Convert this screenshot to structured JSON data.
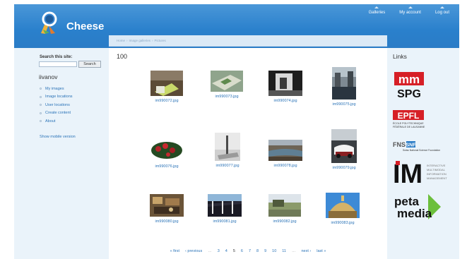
{
  "header": {
    "site_name": "Cheese",
    "nav": [
      "Galleries",
      "My account",
      "Log out"
    ]
  },
  "breadcrumb": [
    "Home",
    "Image galleries",
    "Pictures"
  ],
  "sidebar": {
    "search_label": "Search this site:",
    "search_value": "",
    "search_button": "Search",
    "username": "iivanov",
    "menu": [
      "My images",
      "Image locations",
      "User locations",
      "Create content",
      "About"
    ],
    "mobile_link": "Show mobile version"
  },
  "main": {
    "title": "100",
    "images": [
      {
        "name": "im990072.jpg",
        "scene": "green-cup"
      },
      {
        "name": "im990073.jpg",
        "scene": "tray"
      },
      {
        "name": "im990074.jpg",
        "scene": "bw-indoor"
      },
      {
        "name": "im990075.jpg",
        "scene": "street"
      },
      {
        "name": "im990076.jpg",
        "scene": "flowers"
      },
      {
        "name": "im990077.jpg",
        "scene": "snow-pole"
      },
      {
        "name": "im990078.jpg",
        "scene": "river"
      },
      {
        "name": "im990079.jpg",
        "scene": "car"
      },
      {
        "name": "im990080.jpg",
        "scene": "market"
      },
      {
        "name": "im990081.jpg",
        "scene": "bridge"
      },
      {
        "name": "im990082.jpg",
        "scene": "yard"
      },
      {
        "name": "im990083.jpg",
        "scene": "dome"
      }
    ],
    "pager": {
      "first": "« first",
      "previous": "‹ previous",
      "ellipsis": "…",
      "pages": [
        "3",
        "4",
        "5",
        "6",
        "7",
        "8",
        "9",
        "10",
        "11"
      ],
      "current": "5",
      "next": "next ›",
      "last": "last »"
    }
  },
  "right_sidebar": {
    "title": "Links",
    "partners": [
      {
        "name": "mmspg-logo",
        "line1": "mm",
        "line2": "SPG"
      },
      {
        "name": "epfl-logo",
        "mark": "EPFL",
        "text1": "ÉCOLE POLYTECHNIQUE",
        "text2": "FÉDÉRALE DE LAUSANNE"
      },
      {
        "name": "fns-snf-logo",
        "mark1": "FNS",
        "mark2": "SNF",
        "text": "Swiss National Science Foundation"
      },
      {
        "name": "im2-logo",
        "mark": "IM",
        "text": [
          "INTERACTIVE",
          "MULTIMODAL",
          "INFORMATION",
          "MANAGEMENT"
        ]
      },
      {
        "name": "petamedia-logo",
        "line1": "peta",
        "line2": "media"
      }
    ]
  },
  "colors": {
    "header": "#2a80cc",
    "link": "#2c74b8",
    "sidebar_bg": "#eaf3fa"
  }
}
